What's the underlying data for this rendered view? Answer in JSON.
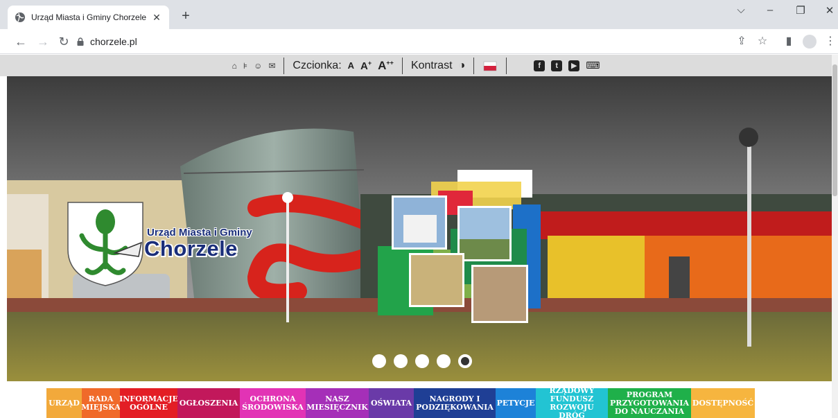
{
  "browser": {
    "tab_title": "Urząd Miasta i Gminy Chorzele",
    "tab_close": "✕",
    "new_tab": "+",
    "url": "chorzele.pl",
    "win_min": "–",
    "win_restore": "❐",
    "win_close": "✕",
    "win_dropdown": "⌵"
  },
  "accessibility_bar": {
    "font_label": "Czcionka:",
    "font_a": "A",
    "font_a_plus": "A",
    "font_a_plus_sup": "+",
    "font_a_plusplus": "A",
    "font_a_plusplus_sup": "++",
    "contrast_label": "Kontrast",
    "social": [
      "f",
      "t",
      "▶"
    ]
  },
  "hero": {
    "brand_line1": "Urząd Miasta i Gminy",
    "brand_line2": "Chorzele",
    "slide_count": 5,
    "active_slide": 5
  },
  "menu": {
    "items": [
      {
        "label": "URZĄD",
        "color": "#f2a93b"
      },
      {
        "label": "RADA MIEJSKA",
        "color": "#f06a2a"
      },
      {
        "label": "INFORMACJE OGÓLNE",
        "color": "#e31e25"
      },
      {
        "label": "OGŁOSZENIA",
        "color": "#c2185b"
      },
      {
        "label": "OCHRONA ŚRODOWISKA",
        "color": "#e233b5"
      },
      {
        "label": "NASZ MIESIĘCZNIK",
        "color": "#a52fb8"
      },
      {
        "label": "OŚWIATA",
        "color": "#6a3aa8"
      },
      {
        "label": "NAGRODY I PODZIĘKOWANIA",
        "color": "#1f3f95"
      },
      {
        "label": "PETYCJE",
        "color": "#1d82d8"
      },
      {
        "label": "RZĄDOWY FUNDUSZ ROZWOJU DRÓG",
        "color": "#22c4d3"
      },
      {
        "label": "PROGRAM PRZYGOTOWANIA DO NAUCZANIA",
        "color": "#1fb04a"
      },
      {
        "label": "DOSTĘPNOŚĆ",
        "color": "#f6b53f"
      }
    ]
  }
}
